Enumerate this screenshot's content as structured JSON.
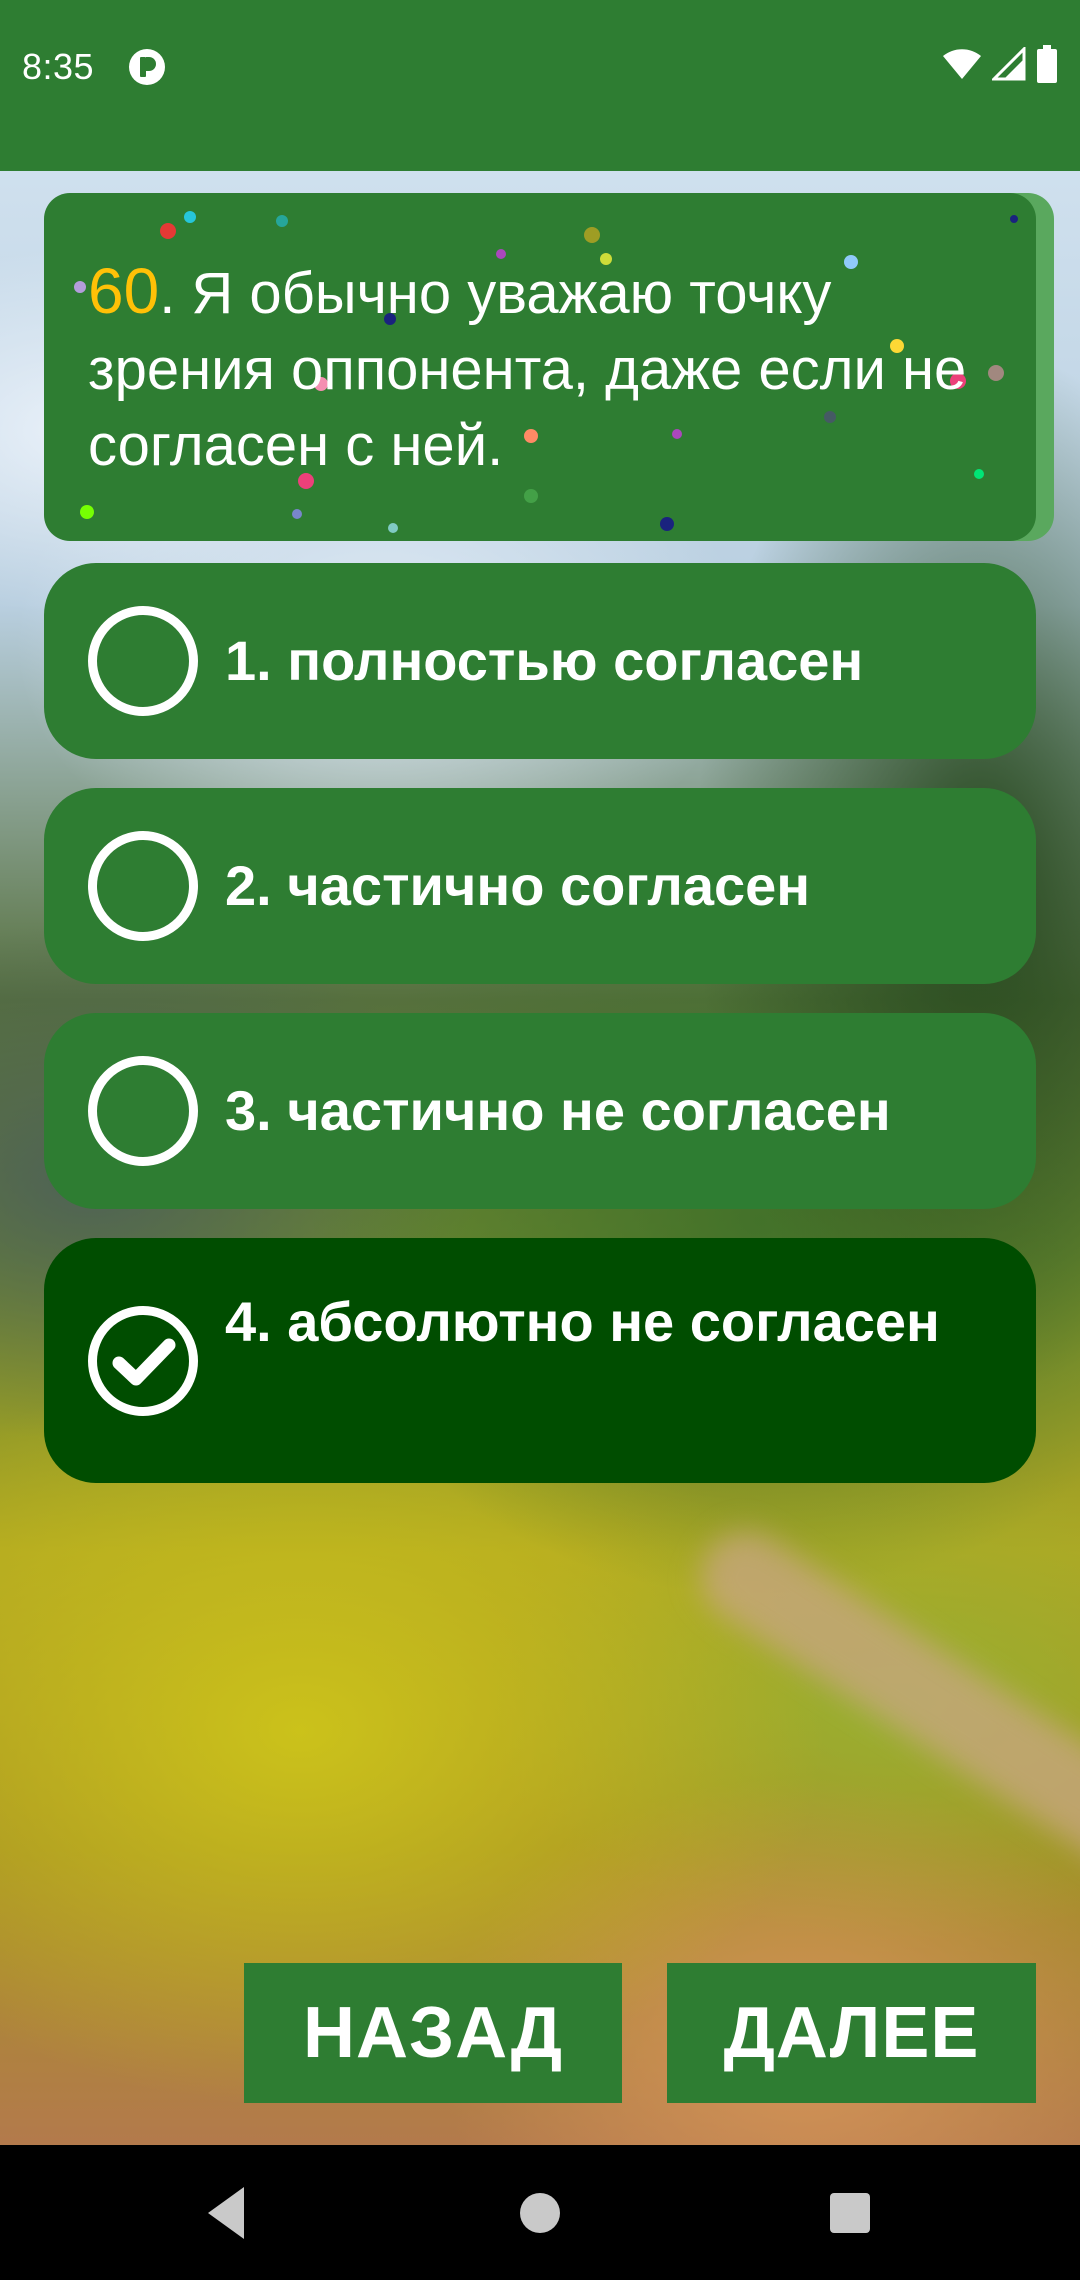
{
  "status_bar": {
    "time": "8:35",
    "app_icon": "circle-p-icon",
    "icons": [
      "wifi-icon",
      "signal-icon",
      "battery-icon"
    ]
  },
  "question": {
    "number": "60",
    "text": ". Я обычно уважаю точку зрения оппонента, даже если не согласен с ней."
  },
  "options": [
    {
      "label": "1. полностью согласен",
      "selected": false
    },
    {
      "label": "2. частично согласен",
      "selected": false
    },
    {
      "label": "3. частично не согласен",
      "selected": false
    },
    {
      "label": "4. абсолютно не согласен",
      "selected": true
    }
  ],
  "buttons": {
    "back": "НАЗАД",
    "next": "ДАЛЕЕ"
  },
  "system_nav": [
    "back-triangle-icon",
    "home-circle-icon",
    "recents-square-icon"
  ],
  "colors": {
    "primary": "#2e7d32",
    "selected": "#004d00",
    "accent_number": "#ffc107",
    "card_edge": "#5aa85e"
  }
}
